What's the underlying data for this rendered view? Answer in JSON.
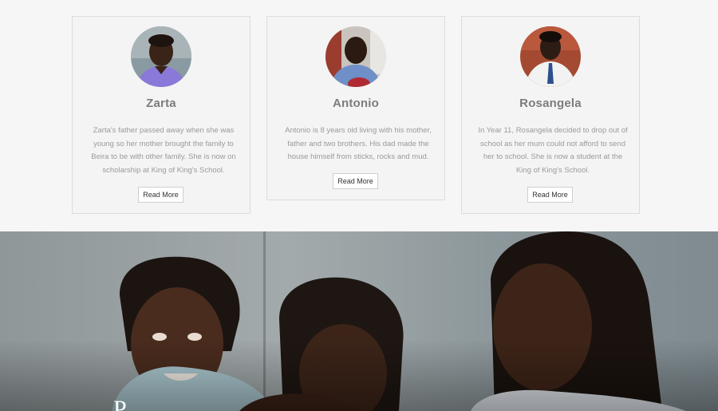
{
  "students": [
    {
      "name": "Zarta",
      "story": "Zarta's father passed away when she was young so her mother brought the family to Beira to be with other family. She is now on scholarship at King of King's School.",
      "button_label": "Read More"
    },
    {
      "name": "Antonio",
      "story": "Antonio is 8 years old living with his mother, father and two brothers. His dad made the house himself from sticks, rocks and mud.",
      "button_label": "Read More"
    },
    {
      "name": "Rosangela",
      "story": "In Year 11, Rosangela decided to drop out of school as her mum could not afford to send her to school. She is now a student at the King of King's School.",
      "button_label": "Read More"
    }
  ],
  "hero": {
    "heading_partial": "P"
  },
  "colors": {
    "card_background": "#f4f4f4",
    "card_border": "#dcdcdc",
    "name_text": "#7c7c7c",
    "story_text": "#9a9a9a"
  }
}
